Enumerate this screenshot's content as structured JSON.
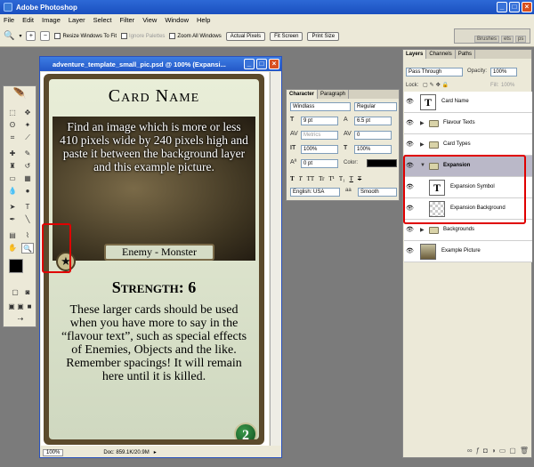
{
  "app": {
    "title": "Adobe Photoshop"
  },
  "menu": [
    "File",
    "Edit",
    "Image",
    "Layer",
    "Select",
    "Filter",
    "View",
    "Window",
    "Help"
  ],
  "options": {
    "resize_windows": "Resize Windows To Fit",
    "ignore_palettes": "Ignore Palettes",
    "zoom_all": "Zoom All Windows",
    "actual_pixels": "Actual Pixels",
    "fit_screen": "Fit Screen",
    "print_size": "Print Size",
    "palette_tabs": [
      "Brushes",
      "ets",
      "ps"
    ]
  },
  "document": {
    "title": "adventure_template_small_pic.psd @ 100% (Expansi...",
    "zoom": "100%",
    "doc_size": "Doc: 859.1K/20.9M"
  },
  "card": {
    "name": "Card Name",
    "image_text": "Find an image which is more or less 410 pixels wide by 240 pixels high and paste it between the background layer and this example picture.",
    "type": "Enemy - Monster",
    "strength": "Strength: 6",
    "flavour": "These larger cards should be used when you have more to say in the “flavour text”, such as special effects of Enemies, Objects and the like. Remember spacings! It will remain here until it is killed.",
    "number": "2"
  },
  "character": {
    "tabs": [
      "Character",
      "Paragraph"
    ],
    "font": "Windlass",
    "style": "Regular",
    "size": "9 pt",
    "leading": "6.5 pt",
    "kerning": "Metrics",
    "tracking": "0",
    "vscale": "100%",
    "hscale": "100%",
    "baseline": "0 pt",
    "color_label": "Color:",
    "text_color": "#000000",
    "styles": [
      "T",
      "T",
      "TT",
      "Tr",
      "T¹",
      "T₁",
      "T",
      "T"
    ],
    "language": "English: USA",
    "aa_label": "a",
    "antialias": "Smooth"
  },
  "layers_panel": {
    "tabs": [
      "Layers",
      "Channels",
      "Paths"
    ],
    "blend": "Pass Through",
    "opacity_label": "Opacity:",
    "opacity": "100%",
    "lock_label": "Lock:",
    "fill_label": "Fill:",
    "fill": "100%",
    "layers": [
      {
        "name": "Card Name",
        "kind": "text"
      },
      {
        "name": "Flavour Texts",
        "kind": "group"
      },
      {
        "name": "Card Types",
        "kind": "group"
      },
      {
        "name": "Expansion",
        "kind": "group-open"
      },
      {
        "name": "Expansion Symbol",
        "kind": "text"
      },
      {
        "name": "Expansion Background",
        "kind": "raster"
      },
      {
        "name": "Backgrounds",
        "kind": "group"
      },
      {
        "name": "Example Picture",
        "kind": "picture"
      }
    ]
  },
  "colors": {
    "foreground": "#000000",
    "background": "#ffffff",
    "highlight": "#e00000",
    "titlebar": "#1f5ccc"
  }
}
